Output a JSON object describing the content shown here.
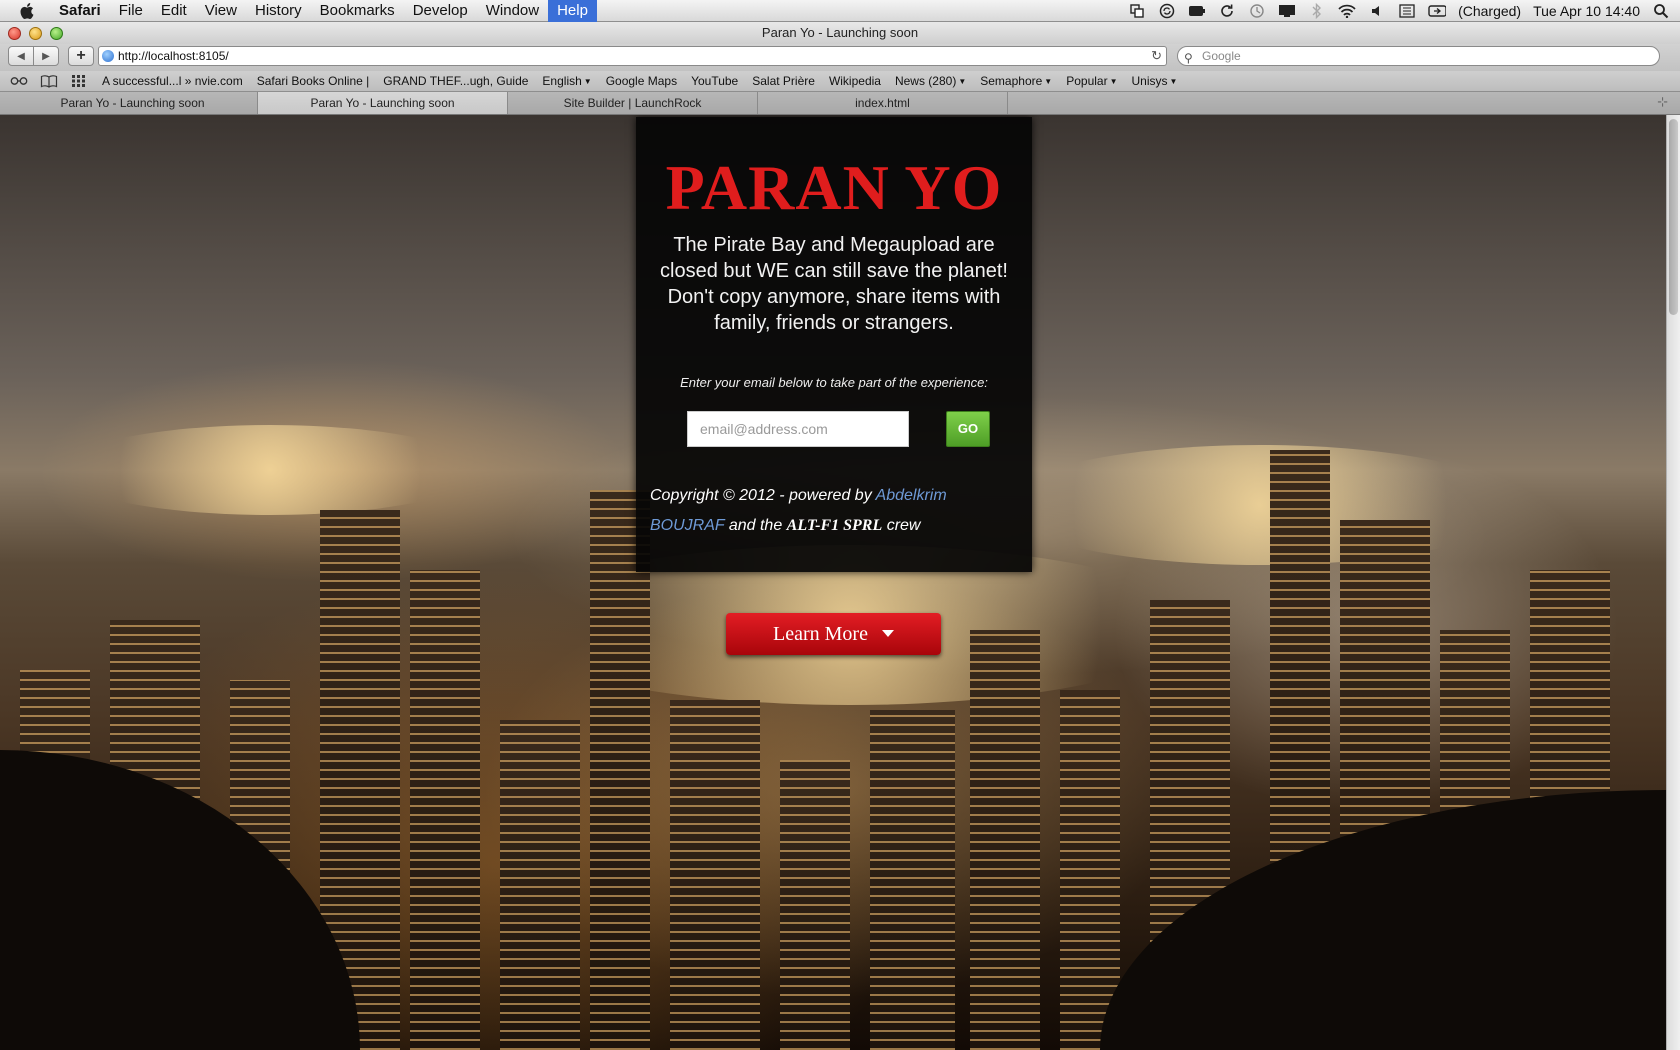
{
  "menubar": {
    "app": "Safari",
    "items": [
      "File",
      "Edit",
      "View",
      "History",
      "Bookmarks",
      "Develop",
      "Window",
      "Help"
    ],
    "active_item": "Help",
    "battery": "(Charged)",
    "clock": "Tue Apr 10  14:40"
  },
  "window": {
    "title": "Paran Yo - Launching soon"
  },
  "toolbar": {
    "url": "http://localhost:8105/",
    "search_placeholder": "Google"
  },
  "bookmarks": {
    "items": [
      {
        "label": "A successful...l » nvie.com",
        "menu": false
      },
      {
        "label": "Safari Books Online |",
        "menu": false
      },
      {
        "label": "GRAND THEF...ugh, Guide",
        "menu": false
      },
      {
        "label": "English",
        "menu": true
      },
      {
        "label": "Google Maps",
        "menu": false
      },
      {
        "label": "YouTube",
        "menu": false
      },
      {
        "label": "Salat Prière",
        "menu": false
      },
      {
        "label": "Wikipedia",
        "menu": false
      },
      {
        "label": "News (280)",
        "menu": true
      },
      {
        "label": "Semaphore",
        "menu": true
      },
      {
        "label": "Popular",
        "menu": true
      },
      {
        "label": "Unisys",
        "menu": true
      }
    ]
  },
  "tabs": [
    {
      "label": "Paran Yo - Launching soon",
      "active": false
    },
    {
      "label": "Paran Yo - Launching soon",
      "active": true
    },
    {
      "label": "Site Builder | LaunchRock",
      "active": false
    },
    {
      "label": "index.html",
      "active": false
    }
  ],
  "page": {
    "brand": "PARAN YO",
    "tagline": "The Pirate Bay and Megaupload are closed but WE can still save the planet! Don't copy anymore, share items with family, friends or strangers.",
    "email_prompt": "Enter your email below to take part of the experience:",
    "email_placeholder": "email@address.com",
    "go_label": "GO",
    "footer": {
      "prefix": "Copyright © 2012 - powered by ",
      "author": "Abdelkrim BOUJRAF",
      "middle": " and the ",
      "company": "ALT-F1 SPRL",
      "suffix": " crew"
    },
    "learn_more": "Learn More"
  },
  "colors": {
    "brand_red": "#e01d1d",
    "go_green": "#5fb534",
    "button_red": "#c4101a",
    "link_blue": "#6e9ad6",
    "menu_highlight": "#3a6fd8"
  }
}
